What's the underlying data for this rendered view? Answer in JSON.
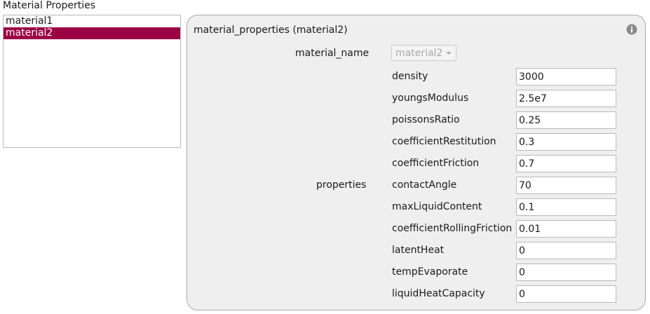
{
  "header": {
    "title": "Material Properties"
  },
  "materials": {
    "items": [
      "material1",
      "material2"
    ],
    "selected": "material2"
  },
  "panel": {
    "title": "material_properties (material2)",
    "info_icon": "info-icon",
    "material_name_label": "material_name",
    "material_name_value": "material2",
    "properties_label": "properties",
    "properties": [
      {
        "label": "density",
        "value": "3000"
      },
      {
        "label": "youngsModulus",
        "value": "2.5e7"
      },
      {
        "label": "poissonsRatio",
        "value": "0.25"
      },
      {
        "label": "coefficientRestitution",
        "value": "0.3"
      },
      {
        "label": "coefficientFriction",
        "value": "0.7"
      },
      {
        "label": "contactAngle",
        "value": "70"
      },
      {
        "label": "maxLiquidContent",
        "value": "0.1"
      },
      {
        "label": "coefficientRollingFriction",
        "value": "0.01"
      },
      {
        "label": "latentHeat",
        "value": "0"
      },
      {
        "label": "tempEvaporate",
        "value": "0"
      },
      {
        "label": "liquidHeatCapacity",
        "value": "0"
      }
    ]
  },
  "colors": {
    "selection": "#9b0044",
    "panel_background": "#efefef"
  }
}
